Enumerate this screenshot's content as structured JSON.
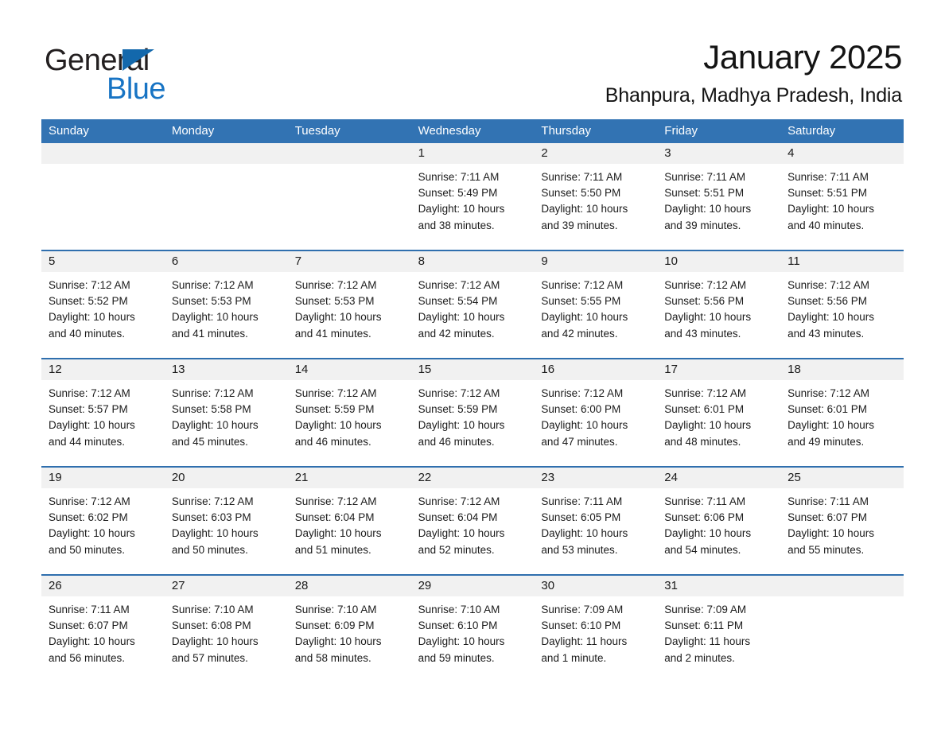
{
  "brand": {
    "word_one": "General",
    "word_two": "Blue",
    "triangle_color": "#1368ac",
    "blue_color": "#1874c4"
  },
  "header": {
    "title": "January 2025",
    "subtitle": "Bhanpura, Madhya Pradesh, India"
  },
  "colors": {
    "header_row_bg": "#3273b3",
    "daynum_bg": "#f1f1f1",
    "week_divider": "#2f6fae"
  },
  "weekdays": [
    "Sunday",
    "Monday",
    "Tuesday",
    "Wednesday",
    "Thursday",
    "Friday",
    "Saturday"
  ],
  "weeks": [
    [
      {
        "day": "",
        "lines": []
      },
      {
        "day": "",
        "lines": []
      },
      {
        "day": "",
        "lines": []
      },
      {
        "day": "1",
        "lines": [
          "Sunrise: 7:11 AM",
          "Sunset: 5:49 PM",
          "Daylight: 10 hours",
          "and 38 minutes."
        ]
      },
      {
        "day": "2",
        "lines": [
          "Sunrise: 7:11 AM",
          "Sunset: 5:50 PM",
          "Daylight: 10 hours",
          "and 39 minutes."
        ]
      },
      {
        "day": "3",
        "lines": [
          "Sunrise: 7:11 AM",
          "Sunset: 5:51 PM",
          "Daylight: 10 hours",
          "and 39 minutes."
        ]
      },
      {
        "day": "4",
        "lines": [
          "Sunrise: 7:11 AM",
          "Sunset: 5:51 PM",
          "Daylight: 10 hours",
          "and 40 minutes."
        ]
      }
    ],
    [
      {
        "day": "5",
        "lines": [
          "Sunrise: 7:12 AM",
          "Sunset: 5:52 PM",
          "Daylight: 10 hours",
          "and 40 minutes."
        ]
      },
      {
        "day": "6",
        "lines": [
          "Sunrise: 7:12 AM",
          "Sunset: 5:53 PM",
          "Daylight: 10 hours",
          "and 41 minutes."
        ]
      },
      {
        "day": "7",
        "lines": [
          "Sunrise: 7:12 AM",
          "Sunset: 5:53 PM",
          "Daylight: 10 hours",
          "and 41 minutes."
        ]
      },
      {
        "day": "8",
        "lines": [
          "Sunrise: 7:12 AM",
          "Sunset: 5:54 PM",
          "Daylight: 10 hours",
          "and 42 minutes."
        ]
      },
      {
        "day": "9",
        "lines": [
          "Sunrise: 7:12 AM",
          "Sunset: 5:55 PM",
          "Daylight: 10 hours",
          "and 42 minutes."
        ]
      },
      {
        "day": "10",
        "lines": [
          "Sunrise: 7:12 AM",
          "Sunset: 5:56 PM",
          "Daylight: 10 hours",
          "and 43 minutes."
        ]
      },
      {
        "day": "11",
        "lines": [
          "Sunrise: 7:12 AM",
          "Sunset: 5:56 PM",
          "Daylight: 10 hours",
          "and 43 minutes."
        ]
      }
    ],
    [
      {
        "day": "12",
        "lines": [
          "Sunrise: 7:12 AM",
          "Sunset: 5:57 PM",
          "Daylight: 10 hours",
          "and 44 minutes."
        ]
      },
      {
        "day": "13",
        "lines": [
          "Sunrise: 7:12 AM",
          "Sunset: 5:58 PM",
          "Daylight: 10 hours",
          "and 45 minutes."
        ]
      },
      {
        "day": "14",
        "lines": [
          "Sunrise: 7:12 AM",
          "Sunset: 5:59 PM",
          "Daylight: 10 hours",
          "and 46 minutes."
        ]
      },
      {
        "day": "15",
        "lines": [
          "Sunrise: 7:12 AM",
          "Sunset: 5:59 PM",
          "Daylight: 10 hours",
          "and 46 minutes."
        ]
      },
      {
        "day": "16",
        "lines": [
          "Sunrise: 7:12 AM",
          "Sunset: 6:00 PM",
          "Daylight: 10 hours",
          "and 47 minutes."
        ]
      },
      {
        "day": "17",
        "lines": [
          "Sunrise: 7:12 AM",
          "Sunset: 6:01 PM",
          "Daylight: 10 hours",
          "and 48 minutes."
        ]
      },
      {
        "day": "18",
        "lines": [
          "Sunrise: 7:12 AM",
          "Sunset: 6:01 PM",
          "Daylight: 10 hours",
          "and 49 minutes."
        ]
      }
    ],
    [
      {
        "day": "19",
        "lines": [
          "Sunrise: 7:12 AM",
          "Sunset: 6:02 PM",
          "Daylight: 10 hours",
          "and 50 minutes."
        ]
      },
      {
        "day": "20",
        "lines": [
          "Sunrise: 7:12 AM",
          "Sunset: 6:03 PM",
          "Daylight: 10 hours",
          "and 50 minutes."
        ]
      },
      {
        "day": "21",
        "lines": [
          "Sunrise: 7:12 AM",
          "Sunset: 6:04 PM",
          "Daylight: 10 hours",
          "and 51 minutes."
        ]
      },
      {
        "day": "22",
        "lines": [
          "Sunrise: 7:12 AM",
          "Sunset: 6:04 PM",
          "Daylight: 10 hours",
          "and 52 minutes."
        ]
      },
      {
        "day": "23",
        "lines": [
          "Sunrise: 7:11 AM",
          "Sunset: 6:05 PM",
          "Daylight: 10 hours",
          "and 53 minutes."
        ]
      },
      {
        "day": "24",
        "lines": [
          "Sunrise: 7:11 AM",
          "Sunset: 6:06 PM",
          "Daylight: 10 hours",
          "and 54 minutes."
        ]
      },
      {
        "day": "25",
        "lines": [
          "Sunrise: 7:11 AM",
          "Sunset: 6:07 PM",
          "Daylight: 10 hours",
          "and 55 minutes."
        ]
      }
    ],
    [
      {
        "day": "26",
        "lines": [
          "Sunrise: 7:11 AM",
          "Sunset: 6:07 PM",
          "Daylight: 10 hours",
          "and 56 minutes."
        ]
      },
      {
        "day": "27",
        "lines": [
          "Sunrise: 7:10 AM",
          "Sunset: 6:08 PM",
          "Daylight: 10 hours",
          "and 57 minutes."
        ]
      },
      {
        "day": "28",
        "lines": [
          "Sunrise: 7:10 AM",
          "Sunset: 6:09 PM",
          "Daylight: 10 hours",
          "and 58 minutes."
        ]
      },
      {
        "day": "29",
        "lines": [
          "Sunrise: 7:10 AM",
          "Sunset: 6:10 PM",
          "Daylight: 10 hours",
          "and 59 minutes."
        ]
      },
      {
        "day": "30",
        "lines": [
          "Sunrise: 7:09 AM",
          "Sunset: 6:10 PM",
          "Daylight: 11 hours",
          "and 1 minute."
        ]
      },
      {
        "day": "31",
        "lines": [
          "Sunrise: 7:09 AM",
          "Sunset: 6:11 PM",
          "Daylight: 11 hours",
          "and 2 minutes."
        ]
      },
      {
        "day": "",
        "lines": []
      }
    ]
  ]
}
